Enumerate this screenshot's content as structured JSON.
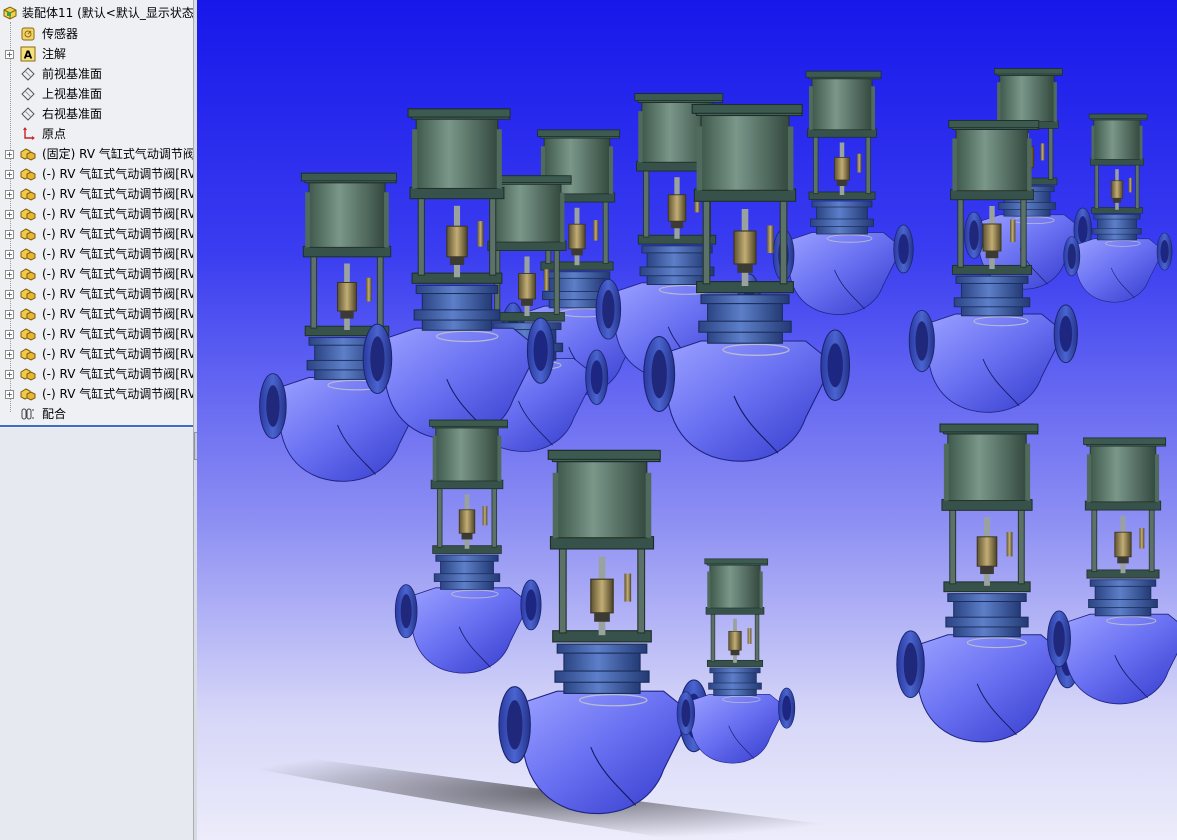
{
  "feature_tree": {
    "root": {
      "label": "装配体11  (默认<默认_显示状态",
      "icon": "assembly-icon"
    },
    "items": [
      {
        "label": "传感器",
        "icon": "sensor-icon",
        "expander": false
      },
      {
        "label": "注解",
        "icon": "annotation-icon",
        "expander": true
      },
      {
        "label": "前视基准面",
        "icon": "plane-icon",
        "expander": false
      },
      {
        "label": "上视基准面",
        "icon": "plane-icon",
        "expander": false
      },
      {
        "label": "右视基准面",
        "icon": "plane-icon",
        "expander": false
      },
      {
        "label": "原点",
        "icon": "origin-icon",
        "expander": false
      },
      {
        "label": "(固定) RV 气缸式气动调节阀",
        "icon": "part-icon",
        "expander": true
      },
      {
        "label": "(-) RV 气缸式气动调节阀[RV",
        "icon": "part-icon",
        "expander": true
      },
      {
        "label": "(-) RV 气缸式气动调节阀[RV",
        "icon": "part-icon",
        "expander": true
      },
      {
        "label": "(-) RV 气缸式气动调节阀[RV",
        "icon": "part-icon",
        "expander": true
      },
      {
        "label": "(-) RV 气缸式气动调节阀[RV",
        "icon": "part-icon",
        "expander": true
      },
      {
        "label": "(-) RV 气缸式气动调节阀[RV",
        "icon": "part-icon",
        "expander": true
      },
      {
        "label": "(-) RV 气缸式气动调节阀[RV",
        "icon": "part-icon",
        "expander": true
      },
      {
        "label": "(-) RV 气缸式气动调节阀[RV",
        "icon": "part-icon",
        "expander": true
      },
      {
        "label": "(-) RV 气缸式气动调节阀[RV",
        "icon": "part-icon",
        "expander": true
      },
      {
        "label": "(-) RV 气缸式气动调节阀[RV",
        "icon": "part-icon",
        "expander": true
      },
      {
        "label": "(-) RV 气缸式气动调节阀[RV",
        "icon": "part-icon",
        "expander": true
      },
      {
        "label": "(-) RV 气缸式气动调节阀[RV",
        "icon": "part-icon",
        "expander": true
      },
      {
        "label": "(-) RV 气缸式气动调节阀[RV",
        "icon": "part-icon",
        "expander": true
      },
      {
        "label": "配合",
        "icon": "mates-icon",
        "expander": false
      }
    ]
  },
  "colors": {
    "valve_body": "#5b63e8",
    "bonnet": "#3f5fa8",
    "cylinder": "#4e6b5c",
    "plate": "#37524a",
    "brass": "#8a7a4e",
    "background_top": "#1717ea",
    "background_bottom": "#ececfb",
    "tree_selection_line": "#3c6cc4"
  },
  "viewport": {
    "model": "pneumatic-cylinder-valve-assembly",
    "valve_count": 14
  }
}
